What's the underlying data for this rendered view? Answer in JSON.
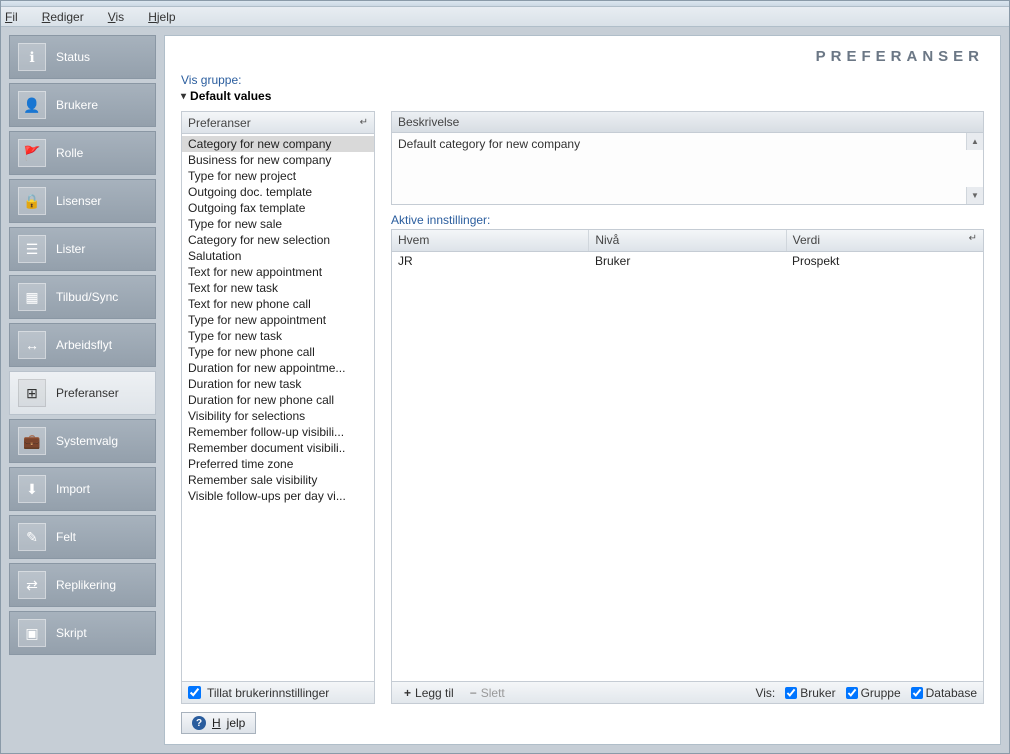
{
  "menu": {
    "fil": "Fil",
    "rediger": "Rediger",
    "vis": "Vis",
    "hjelp": "Hjelp"
  },
  "sidebar": {
    "items": [
      {
        "label": "Status",
        "icon": "ℹ"
      },
      {
        "label": "Brukere",
        "icon": "👤"
      },
      {
        "label": "Rolle",
        "icon": "🚩"
      },
      {
        "label": "Lisenser",
        "icon": "🔒"
      },
      {
        "label": "Lister",
        "icon": "☰"
      },
      {
        "label": "Tilbud/Sync",
        "icon": "▦"
      },
      {
        "label": "Arbeidsflyt",
        "icon": "↔"
      },
      {
        "label": "Preferanser",
        "icon": "⊞"
      },
      {
        "label": "Systemvalg",
        "icon": "💼"
      },
      {
        "label": "Import",
        "icon": "⬇"
      },
      {
        "label": "Felt",
        "icon": "✎"
      },
      {
        "label": "Replikering",
        "icon": "⇄"
      },
      {
        "label": "Skript",
        "icon": "▣"
      }
    ],
    "selected_index": 7
  },
  "page": {
    "title": "PREFERANSER",
    "group_label": "Vis gruppe:",
    "group_value": "Default values"
  },
  "prefs": {
    "header": "Preferanser",
    "items": [
      "Category for new company",
      "Business for new company",
      "Type for new project",
      "Outgoing doc. template",
      "Outgoing fax template",
      "Type for new sale",
      "Category for new selection",
      "Salutation",
      "Text for new appointment",
      "Text for new task",
      "Text for new phone call",
      "Type for new appointment",
      "Type for new task",
      "Type for new phone call",
      "Duration for new appointme...",
      "Duration for new task",
      "Duration for new phone call",
      "Visibility for selections",
      "Remember follow-up visibili...",
      "Remember document visibili..",
      "Preferred time zone",
      "Remember sale visibility",
      "Visible follow-ups per day vi..."
    ],
    "selected_index": 0,
    "allow_user_label": "Tillat brukerinnstillinger"
  },
  "desc": {
    "header": "Beskrivelse",
    "text": "Default category for new company"
  },
  "active": {
    "label": "Aktive innstillinger:",
    "columns": {
      "hvem": "Hvem",
      "niva": "Nivå",
      "verdi": "Verdi"
    },
    "rows": [
      {
        "hvem": "JR",
        "niva": "Bruker",
        "verdi": "Prospekt"
      }
    ]
  },
  "footer": {
    "legg_til": "Legg til",
    "slett": "Slett",
    "vis": "Vis:",
    "bruker": "Bruker",
    "gruppe": "Gruppe",
    "database": "Database"
  },
  "help": "Hjelp"
}
